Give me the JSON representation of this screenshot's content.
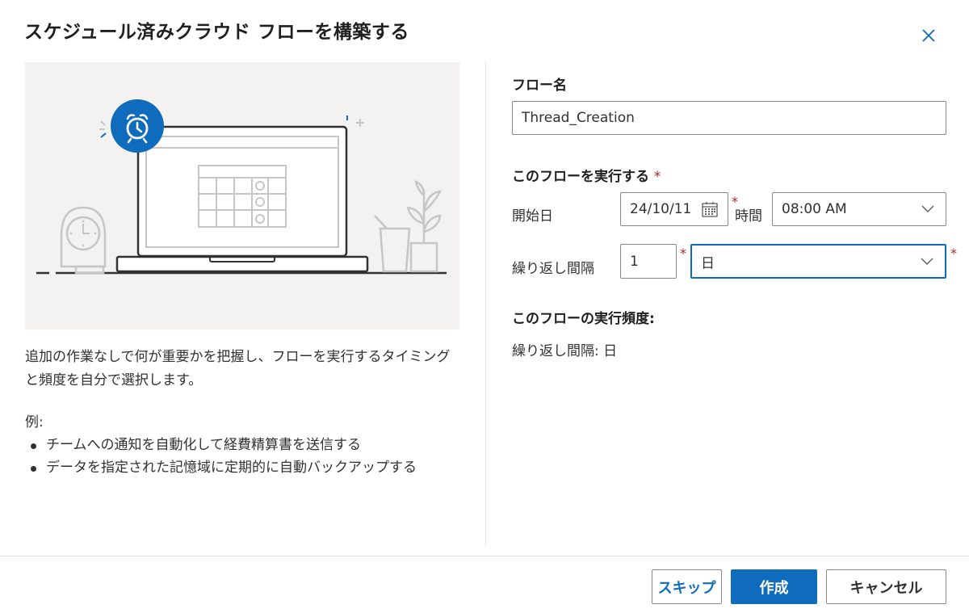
{
  "dialog": {
    "title": "スケジュール済みクラウド フローを構築する"
  },
  "left": {
    "description": "追加の作業なしで何が重要かを把握し、フローを実行するタイミングと頻度を自分で選択します。",
    "examples_heading": "例:",
    "examples": [
      "チームへの通知を自動化して経費精算書を送信する",
      "データを指定された記憶域に定期的に自動バックアップする"
    ]
  },
  "form": {
    "flow_name_label": "フロー名",
    "flow_name_value": "Thread_Creation",
    "run_section_label": "このフローを実行する",
    "required_mark": "*",
    "start_date_label": "開始日",
    "start_date_value": "24/10/11",
    "time_label": "時間",
    "time_value": "08:00 AM",
    "interval_label": "繰り返し間隔",
    "interval_value": "1",
    "frequency_value": "日",
    "summary_label": "このフローの実行頻度:",
    "summary_text": "繰り返し間隔: 日"
  },
  "buttons": {
    "skip": "スキップ",
    "create": "作成",
    "cancel": "キャンセル"
  },
  "colors": {
    "accent": "#0f6cbd",
    "required": "#a4262c"
  }
}
